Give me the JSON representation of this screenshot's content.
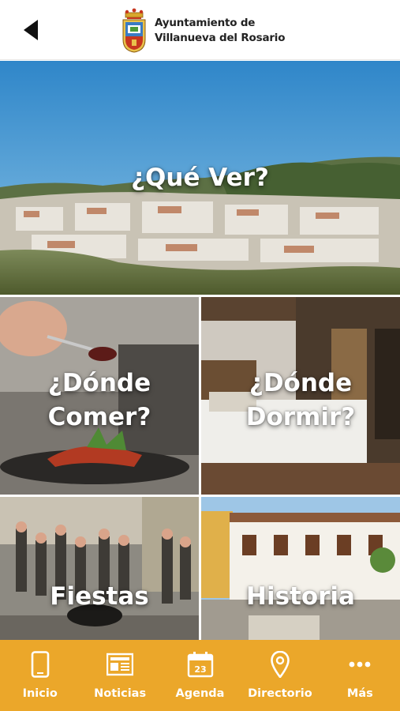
{
  "header": {
    "back_icon": "back-arrow-icon",
    "logo_icon": "coat-of-arms-icon",
    "title_line1": "Ayuntamiento de",
    "title_line2": "Villanueva del Rosario"
  },
  "tiles": {
    "que_ver": {
      "label": "¿Qué Ver?"
    },
    "donde_comer": {
      "label": "¿Dónde\nComer?"
    },
    "donde_dormir": {
      "label": "¿Dónde\nDormir?"
    },
    "fiestas": {
      "label": "Fiestas"
    },
    "historia": {
      "label": "Historia"
    }
  },
  "nav": {
    "items": [
      {
        "label": "Inicio",
        "icon": "phone-icon"
      },
      {
        "label": "Noticias",
        "icon": "newspaper-icon"
      },
      {
        "label": "Agenda",
        "icon": "calendar-icon",
        "icon_text": "23"
      },
      {
        "label": "Directorio",
        "icon": "map-pin-icon"
      },
      {
        "label": "Más",
        "icon": "more-dots-icon"
      }
    ]
  },
  "colors": {
    "nav_background": "#eba72a",
    "tile_text": "#ffffff",
    "header_text": "#222222"
  }
}
